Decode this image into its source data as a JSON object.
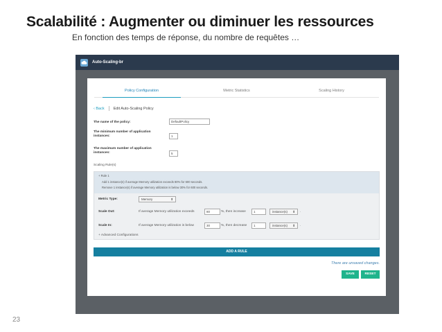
{
  "slide": {
    "title": "Scalabilité : Augmenter ou diminuer les ressources",
    "subtitle": "En fonction des temps de réponse, du nombre de requêtes …",
    "page_number": "23"
  },
  "app": {
    "title": "Auto-Scaling-br",
    "icon": "cloud-app-icon"
  },
  "tabs": [
    {
      "label": "Policy Configuration",
      "active": true
    },
    {
      "label": "Metric Statistics",
      "active": false
    },
    {
      "label": "Scaling History",
      "active": false
    }
  ],
  "breadcrumb": {
    "back": "‹ Back",
    "current": "Edit Auto-Scaling Policy"
  },
  "form": {
    "policy_name_label": "The name of the policy:",
    "policy_name_value": "DefaultPolicy",
    "min_instances_label_1": "The minimum number of application",
    "min_instances_label_2": "instances:",
    "min_instances_value": "1",
    "max_instances_label_1": "The maximum number of application",
    "max_instances_label_2": "instances:",
    "max_instances_value": "5",
    "scaling_rules_label": "Scaling Rule(s)"
  },
  "rule": {
    "title": "+ Rule 1",
    "summary_1": "Add 1 instance(s) if average Memory utilization exceeds 80% for 600 seconds.",
    "summary_2": "Remove 1 instance(s) if average Memory utilization is below 30% for 600 seconds.",
    "metric_type_label": "Metric Type:",
    "metric_type_value": "Memory",
    "scale_out_label": "Scale Out:",
    "scale_out_text": "If average Memory utilization exceeds",
    "scale_out_threshold": "80",
    "scale_out_mid": "%, then increase",
    "scale_out_count": "1",
    "scale_out_unit": "instance(s)",
    "scale_in_label": "Scale In:",
    "scale_in_text": "If average Memory utilization is below",
    "scale_in_threshold": "30",
    "scale_in_mid": "%, then decrease",
    "scale_in_count": "1",
    "scale_in_unit": "instance(s)",
    "period": ".",
    "advanced": "+ Advanced Configurations"
  },
  "actions": {
    "add_rule": "ADD A RULE",
    "unsaved": "There are unsaved changes.",
    "save": "SAVE",
    "reset": "RESET"
  },
  "colors": {
    "header_bg": "#2b3a4d",
    "accent": "#1a9cbe",
    "add_rule_bg": "#157fa0",
    "button_green": "#1fb48c"
  }
}
